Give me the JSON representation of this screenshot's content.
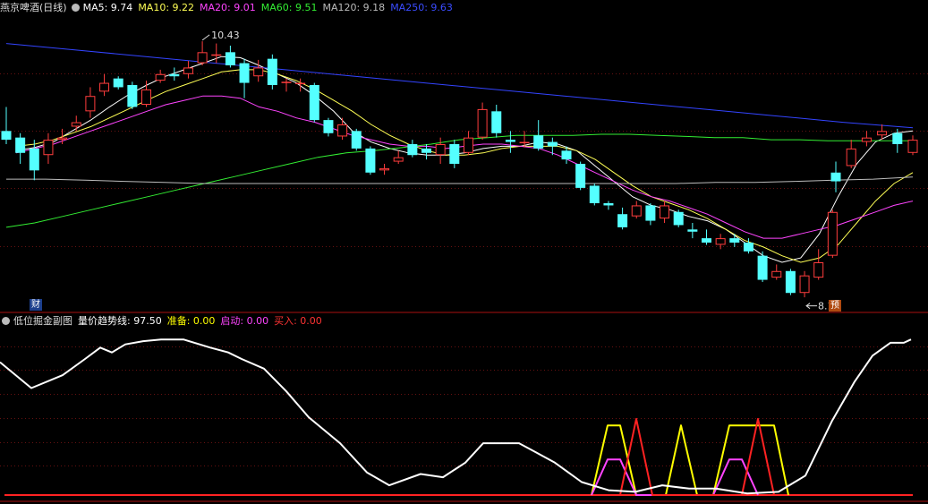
{
  "main_header": {
    "title": "燕京啤酒(日线)",
    "ma5": "MA5: 9.74",
    "ma10": "MA10: 9.22",
    "ma20": "MA20: 9.01",
    "ma60": "MA60: 9.51",
    "ma120": "MA120: 9.18",
    "ma250": "MA250: 9.63"
  },
  "sub_header": {
    "title": "低位掘金副图",
    "trend": "量价趋势线: 97.50",
    "prepare": "准备: 0.00",
    "start": "启动: 0.00",
    "buy": "买入: 0.00"
  },
  "annotations": {
    "high": "10.43",
    "low": "8.10"
  },
  "badges": {
    "cai": "财",
    "yu": "预"
  },
  "colors": {
    "bull": "#ff3d3d",
    "bear": "#54ffff",
    "ma5": "#ffffff",
    "ma10": "#ffff55",
    "ma20": "#ff44ff",
    "ma60": "#33ee33",
    "ma120": "#bbbbbb",
    "ma250": "#3344ff",
    "trend": "#ffffff",
    "prepare": "#ffff00",
    "start": "#ff44ff",
    "buy": "#ff2222"
  },
  "chart_data": [
    {
      "type": "candlestick",
      "title": "燕京啤酒(日线)",
      "ylim": [
        7.95,
        10.65
      ],
      "high_marker": 10.43,
      "low_marker": 8.1,
      "candles": [
        [
          9.6,
          9.52,
          9.82,
          9.48
        ],
        [
          9.54,
          9.4,
          9.58,
          9.3
        ],
        [
          9.44,
          9.24,
          9.52,
          9.15
        ],
        [
          9.38,
          9.52,
          9.58,
          9.3
        ],
        [
          9.52,
          9.54,
          9.62,
          9.48
        ],
        [
          9.64,
          9.68,
          9.74,
          9.6
        ],
        [
          9.78,
          9.92,
          10.0,
          9.72
        ],
        [
          9.96,
          10.04,
          10.12,
          9.92
        ],
        [
          10.08,
          10.0,
          10.1,
          9.98
        ],
        [
          10.02,
          9.82,
          10.05,
          9.8
        ],
        [
          9.84,
          9.98,
          10.06,
          9.82
        ],
        [
          10.06,
          10.12,
          10.16,
          10.04
        ],
        [
          10.12,
          10.1,
          10.18,
          10.06
        ],
        [
          10.12,
          10.18,
          10.24,
          10.08
        ],
        [
          10.22,
          10.32,
          10.42,
          10.2
        ],
        [
          10.3,
          10.3,
          10.4,
          10.22
        ],
        [
          10.32,
          10.2,
          10.38,
          10.18
        ],
        [
          10.22,
          10.04,
          10.26,
          9.9
        ],
        [
          10.1,
          10.18,
          10.25,
          10.05
        ],
        [
          10.26,
          10.02,
          10.3,
          9.98
        ],
        [
          10.05,
          10.05,
          10.08,
          9.96
        ],
        [
          10.04,
          10.04,
          10.08,
          9.96
        ],
        [
          10.02,
          9.7,
          10.04,
          9.68
        ],
        [
          9.7,
          9.58,
          9.72,
          9.55
        ],
        [
          9.55,
          9.66,
          9.72,
          9.52
        ],
        [
          9.6,
          9.44,
          9.62,
          9.42
        ],
        [
          9.44,
          9.22,
          9.46,
          9.2
        ],
        [
          9.24,
          9.26,
          9.3,
          9.2
        ],
        [
          9.32,
          9.36,
          9.42,
          9.3
        ],
        [
          9.48,
          9.38,
          9.52,
          9.36
        ],
        [
          9.44,
          9.4,
          9.48,
          9.34
        ],
        [
          9.38,
          9.48,
          9.54,
          9.3
        ],
        [
          9.48,
          9.3,
          9.52,
          9.26
        ],
        [
          9.4,
          9.54,
          9.6,
          9.38
        ],
        [
          9.54,
          9.8,
          9.86,
          9.52
        ],
        [
          9.78,
          9.58,
          9.84,
          9.54
        ],
        [
          9.52,
          9.5,
          9.6,
          9.4
        ],
        [
          9.5,
          9.5,
          9.6,
          9.45
        ],
        [
          9.56,
          9.44,
          9.7,
          9.42
        ],
        [
          9.5,
          9.46,
          9.54,
          9.38
        ],
        [
          9.42,
          9.34,
          9.46,
          9.3
        ],
        [
          9.3,
          9.08,
          9.32,
          9.06
        ],
        [
          9.1,
          8.94,
          9.12,
          8.92
        ],
        [
          8.94,
          8.92,
          8.96,
          8.88
        ],
        [
          8.84,
          8.72,
          8.9,
          8.7
        ],
        [
          8.82,
          8.92,
          8.96,
          8.8
        ],
        [
          8.92,
          8.78,
          8.94,
          8.74
        ],
        [
          8.8,
          8.92,
          8.96,
          8.76
        ],
        [
          8.86,
          8.74,
          8.88,
          8.72
        ],
        [
          8.7,
          8.68,
          8.76,
          8.62
        ],
        [
          8.62,
          8.58,
          8.7,
          8.56
        ],
        [
          8.56,
          8.62,
          8.66,
          8.52
        ],
        [
          8.62,
          8.58,
          8.66,
          8.54
        ],
        [
          8.58,
          8.5,
          8.62,
          8.48
        ],
        [
          8.46,
          8.24,
          8.5,
          8.22
        ],
        [
          8.26,
          8.32,
          8.38,
          8.24
        ],
        [
          8.32,
          8.12,
          8.34,
          8.1
        ],
        [
          8.12,
          8.28,
          8.32,
          8.08
        ],
        [
          8.26,
          8.4,
          8.52,
          8.24
        ],
        [
          8.46,
          8.86,
          8.88,
          8.44
        ],
        [
          9.22,
          9.14,
          9.32,
          9.04
        ],
        [
          9.28,
          9.44,
          9.52,
          9.26
        ],
        [
          9.5,
          9.54,
          9.6,
          9.46
        ],
        [
          9.56,
          9.6,
          9.66,
          9.52
        ],
        [
          9.58,
          9.48,
          9.62,
          9.4
        ],
        [
          9.4,
          9.52,
          9.56,
          9.38
        ]
      ],
      "gap_after_index": 59,
      "ma_lines": {
        "MA5": [
          9.42,
          9.45,
          9.5,
          9.6,
          9.7,
          9.82,
          9.93,
          10.02,
          10.1,
          10.16,
          10.22,
          10.28,
          10.27,
          10.2,
          10.12,
          10.04,
          9.92,
          9.78,
          9.6,
          9.5,
          9.44,
          9.4,
          9.38,
          9.38,
          9.4,
          9.44,
          9.46,
          9.46,
          9.5,
          9.48,
          9.42,
          9.28,
          9.14,
          9.0,
          8.92,
          8.88,
          8.82,
          8.78,
          8.7,
          8.58,
          8.46,
          8.4,
          8.44,
          8.66,
          9.0,
          9.3,
          9.5,
          9.58,
          9.6
        ],
        "MA10": [
          9.46,
          9.48,
          9.52,
          9.58,
          9.64,
          9.72,
          9.8,
          9.88,
          9.96,
          10.02,
          10.08,
          10.14,
          10.16,
          10.16,
          10.12,
          10.06,
          9.98,
          9.88,
          9.78,
          9.66,
          9.56,
          9.48,
          9.42,
          9.38,
          9.38,
          9.4,
          9.44,
          9.46,
          9.46,
          9.46,
          9.42,
          9.34,
          9.22,
          9.1,
          9.0,
          8.94,
          8.88,
          8.8,
          8.7,
          8.6,
          8.54,
          8.46,
          8.4,
          8.44,
          8.56,
          8.76,
          8.96,
          9.12,
          9.22
        ],
        "MA20": [
          9.4,
          9.44,
          9.48,
          9.54,
          9.6,
          9.66,
          9.72,
          9.78,
          9.84,
          9.88,
          9.92,
          9.92,
          9.9,
          9.82,
          9.78,
          9.72,
          9.68,
          9.62,
          9.56,
          9.52,
          9.48,
          9.46,
          9.46,
          9.44,
          9.46,
          9.48,
          9.48,
          9.46,
          9.44,
          9.38,
          9.3,
          9.22,
          9.14,
          9.06,
          9.0,
          8.96,
          8.9,
          8.84,
          8.76,
          8.68,
          8.62,
          8.62,
          8.66,
          8.7,
          8.74,
          8.8,
          8.86,
          8.92,
          8.96
        ],
        "MA60": [
          8.72,
          8.76,
          8.82,
          8.88,
          8.94,
          9.0,
          9.06,
          9.12,
          9.18,
          9.24,
          9.3,
          9.36,
          9.4,
          9.42,
          9.45,
          9.48,
          9.52,
          9.54,
          9.56,
          9.56,
          9.56,
          9.57,
          9.57,
          9.56,
          9.55,
          9.54,
          9.54,
          9.52,
          9.52,
          9.51,
          9.51,
          9.51,
          9.51
        ],
        "MA120": [
          9.16,
          9.16,
          9.15,
          9.14,
          9.13,
          9.12,
          9.12,
          9.12,
          9.12,
          9.12,
          9.12,
          9.12,
          9.12,
          9.12,
          9.12,
          9.12,
          9.12,
          9.12,
          9.13,
          9.13,
          9.14,
          9.15,
          9.16,
          9.18
        ],
        "MA250": [
          10.4,
          10.34,
          10.28,
          10.22,
          10.16,
          10.1,
          10.04,
          9.98,
          9.92,
          9.86,
          9.8,
          9.74,
          9.68,
          9.63
        ]
      }
    },
    {
      "type": "line",
      "title": "低位掘金副图",
      "ylim": [
        0,
        100
      ],
      "series": [
        {
          "name": "量价趋势线",
          "values": [
            [
              0,
              82
            ],
            [
              35,
              66
            ],
            [
              70,
              74
            ],
            [
              95,
              84
            ],
            [
              112,
              91
            ],
            [
              125,
              88
            ],
            [
              140,
              93
            ],
            [
              160,
              95
            ],
            [
              180,
              96
            ],
            [
              205,
              96
            ],
            [
              235,
              91
            ],
            [
              255,
              88
            ],
            [
              270,
              84
            ],
            [
              295,
              78
            ],
            [
              320,
              64
            ],
            [
              345,
              48
            ],
            [
              380,
              32
            ],
            [
              410,
              14
            ],
            [
              435,
              6
            ],
            [
              470,
              13
            ],
            [
              495,
              11
            ],
            [
              520,
              20
            ],
            [
              540,
              32
            ],
            [
              580,
              32
            ],
            [
              600,
              26
            ],
            [
              620,
              20
            ],
            [
              650,
              8
            ],
            [
              680,
              3
            ],
            [
              710,
              2
            ],
            [
              740,
              6
            ],
            [
              770,
              4
            ],
            [
              800,
              4
            ],
            [
              835,
              1
            ],
            [
              870,
              2
            ],
            [
              900,
              12
            ],
            [
              930,
              46
            ],
            [
              955,
              70
            ],
            [
              975,
              86
            ],
            [
              995,
              94
            ],
            [
              1010,
              94
            ],
            [
              1018,
              96
            ]
          ]
        },
        {
          "name": "准备",
          "values": [
            [
              661,
              0
            ],
            [
              679,
              43
            ],
            [
              693,
              43
            ],
            [
              711,
              0
            ],
            [
              744,
              0
            ],
            [
              761,
              43
            ],
            [
              779,
              0
            ],
            [
              797,
              0
            ],
            [
              815,
              43
            ],
            [
              865,
              43
            ],
            [
              881,
              0
            ]
          ]
        },
        {
          "name": "启动",
          "values": [
            [
              661,
              0
            ],
            [
              679,
              22
            ],
            [
              693,
              22
            ],
            [
              711,
              0
            ],
            [
              797,
              0
            ],
            [
              815,
              22
            ],
            [
              829,
              22
            ],
            [
              847,
              0
            ]
          ]
        },
        {
          "name": "买入",
          "values": [
            [
              693,
              0
            ],
            [
              711,
              47
            ],
            [
              729,
              0
            ],
            [
              829,
              0
            ],
            [
              847,
              47
            ],
            [
              865,
              0
            ]
          ]
        }
      ]
    }
  ]
}
